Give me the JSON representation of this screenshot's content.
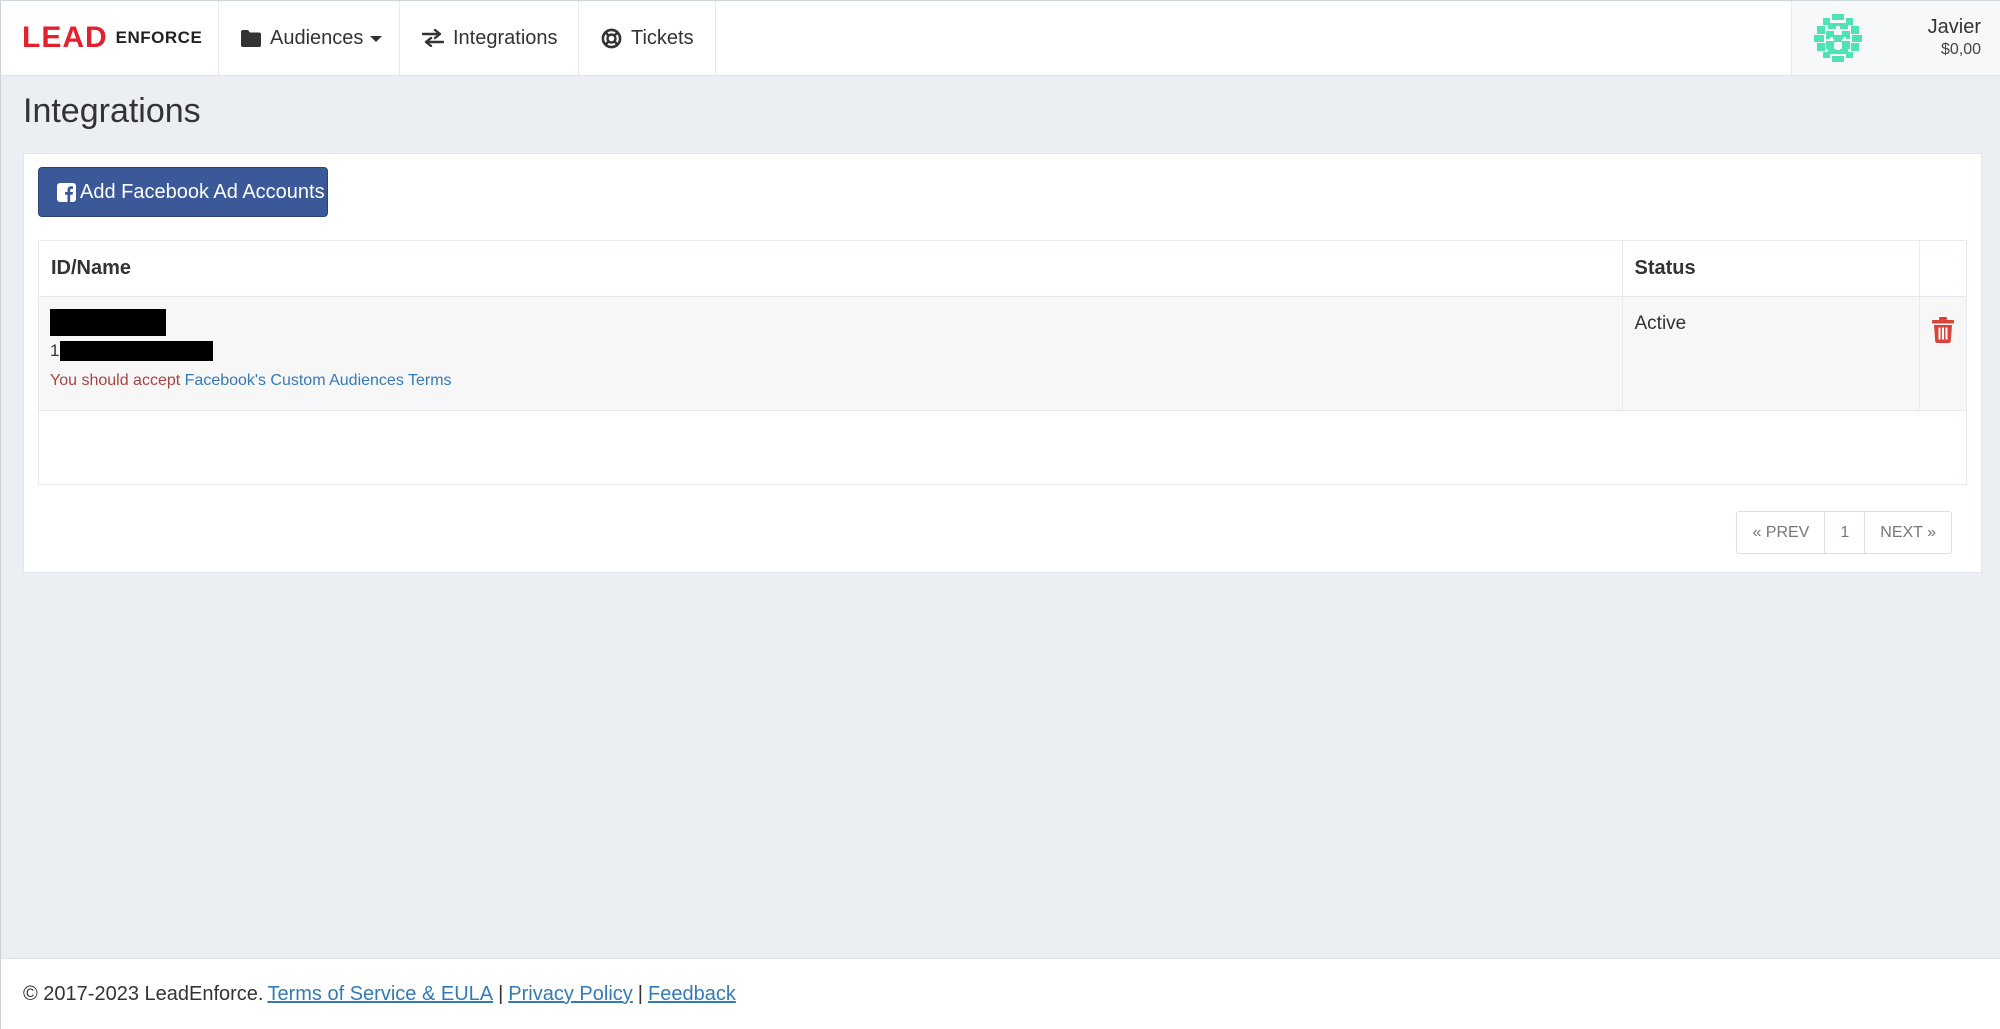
{
  "brand": {
    "lead": "LEAD",
    "enforce": "ENFORCE",
    "accent_color": "#e3212e"
  },
  "nav": {
    "audiences": {
      "label": "Audiences",
      "icon": "folder-icon"
    },
    "integrations": {
      "label": "Integrations",
      "icon": "exchange-arrows-icon"
    },
    "tickets": {
      "label": "Tickets",
      "icon": "life-ring-icon"
    }
  },
  "user": {
    "name": "Javier",
    "balance": "$0,00",
    "avatar": "identicon-avatar"
  },
  "page": {
    "title": "Integrations"
  },
  "add_button": {
    "label": "Add Facebook Ad Accounts",
    "icon": "facebook-square-icon",
    "color": "#3b5998"
  },
  "table": {
    "headers": {
      "name": "ID/Name",
      "status": "Status",
      "actions": ""
    },
    "rows": [
      {
        "name": "[redacted]",
        "id_prefix": "1",
        "id": "[redacted]",
        "warning": "You should accept",
        "terms_link": "Facebook's Custom Audiences Terms",
        "status": "Active",
        "action_icon": "trash-icon"
      }
    ]
  },
  "pagination": {
    "prev": "« PREV",
    "current": "1",
    "next": "NEXT »"
  },
  "footer": {
    "copyright": "© 2017-2023 LeadEnforce.",
    "terms": "Terms of Service & EULA",
    "privacy": "Privacy Policy",
    "feedback": "Feedback",
    "separator": "|"
  }
}
